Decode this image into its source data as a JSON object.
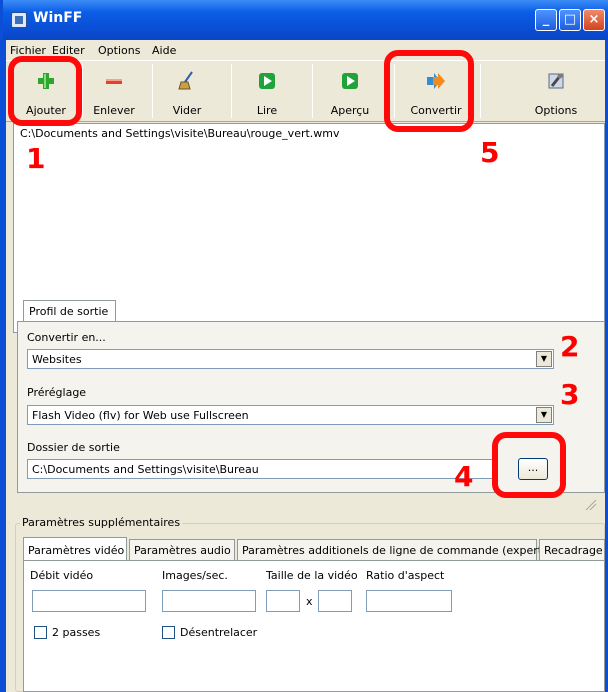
{
  "window": {
    "title": "WinFF",
    "controls": {
      "minimize": "_",
      "maximize": "□",
      "close": "×"
    }
  },
  "menu": [
    "Fichier",
    "Editer",
    "Options",
    "Aide"
  ],
  "toolbar": [
    {
      "label": "Ajouter",
      "icon": "add-icon"
    },
    {
      "label": "Enlever",
      "icon": "remove-icon"
    },
    {
      "label": "Vider",
      "icon": "broom-icon"
    },
    {
      "label": "Lire",
      "icon": "play-icon"
    },
    {
      "label": "Aperçu",
      "icon": "preview-icon"
    },
    {
      "label": "Convertir",
      "icon": "convert-icon"
    },
    {
      "label": "Options",
      "icon": "options-icon"
    }
  ],
  "files": [
    "C:\\Documents and Settings\\visite\\Bureau\\rouge_vert.wmv"
  ],
  "profile": {
    "tab": "Profil de sortie",
    "convert_label": "Convertir en...",
    "convert_value": "Websites",
    "preset_label": "Préréglage",
    "preset_value": "Flash Video (flv) for Web use Fullscreen",
    "output_label": "Dossier de sortie",
    "output_value": "C:\\Documents and Settings\\visite\\Bureau",
    "browse_label": "..."
  },
  "extra": {
    "legend": "Paramètres supplémentaires",
    "tabs": [
      "Paramètres vidéo",
      "Paramètres audio",
      "Paramètres additionels de ligne de commande (expert)",
      "Recadrage"
    ],
    "video": {
      "bitrate_label": "Débit vidéo",
      "fps_label": "Images/sec.",
      "size_label": "Taille de la vidéo",
      "size_separator": "x",
      "aspect_label": "Ratio d'aspect",
      "two_pass_label": "2 passes",
      "deinterlace_label": "Désentrelacer"
    }
  },
  "annotations": {
    "step1": "1",
    "step2": "2",
    "step3": "3",
    "step4": "4",
    "step5": "5"
  },
  "colors": {
    "annotation": "#ff0000",
    "titlebar": "#0a4fd6",
    "client": "#ece9d8"
  }
}
